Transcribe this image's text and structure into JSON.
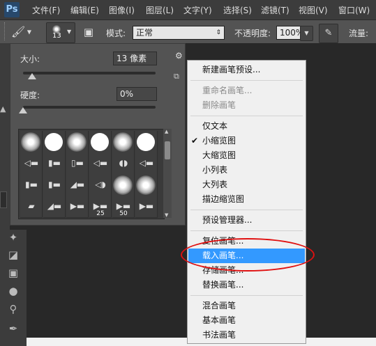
{
  "app": {
    "logo": "Ps"
  },
  "menubar": {
    "items": [
      "文件(F)",
      "编辑(E)",
      "图像(I)",
      "图层(L)",
      "文字(Y)",
      "选择(S)",
      "滤镜(T)",
      "视图(V)",
      "窗口(W)"
    ]
  },
  "options": {
    "brush_size": "13",
    "mode_label": "模式:",
    "mode_value": "正常",
    "opacity_label": "不透明度:",
    "opacity_value": "100%",
    "flow_label": "流量:"
  },
  "brush_panel": {
    "size_label": "大小:",
    "size_value": "13 像素",
    "hardness_label": "硬度:",
    "hardness_value": "0%",
    "size_slider_fraction": 0.07,
    "hardness_slider_fraction": 0.0,
    "preset_rows": [
      [
        {
          "kind": "soft"
        },
        {
          "kind": "hard"
        },
        {
          "kind": "soft"
        },
        {
          "kind": "hard"
        },
        {
          "kind": "soft"
        },
        {
          "kind": "hard"
        }
      ],
      [
        {
          "kind": "tip",
          "glyph": "◁▬"
        },
        {
          "kind": "tip",
          "glyph": "▮▬"
        },
        {
          "kind": "tip",
          "glyph": "▯▬"
        },
        {
          "kind": "tip",
          "glyph": "◁▬"
        },
        {
          "kind": "tip",
          "glyph": "◖◗"
        },
        {
          "kind": "tip",
          "glyph": "◁▬"
        }
      ],
      [
        {
          "kind": "tip",
          "glyph": "▮▬"
        },
        {
          "kind": "tip",
          "glyph": "▮▬"
        },
        {
          "kind": "tip",
          "glyph": "◢▬"
        },
        {
          "kind": "tip",
          "glyph": "◁◗"
        },
        {
          "kind": "soft"
        },
        {
          "kind": "soft"
        }
      ],
      [
        {
          "kind": "tip",
          "glyph": "▰"
        },
        {
          "kind": "tip",
          "glyph": "◢▬"
        },
        {
          "kind": "tip",
          "glyph": "▶▬"
        },
        {
          "kind": "tip",
          "glyph": "▶▬",
          "num": "25"
        },
        {
          "kind": "tip",
          "glyph": "▶▬",
          "num": "50"
        },
        {
          "kind": "tip",
          "glyph": "▶▬"
        }
      ]
    ]
  },
  "context_menu": {
    "items": [
      {
        "label": "新建画笔预设..."
      },
      {
        "sep": true
      },
      {
        "label": "重命名画笔...",
        "disabled": true
      },
      {
        "label": "删除画笔",
        "disabled": true
      },
      {
        "sep": true
      },
      {
        "label": "仅文本"
      },
      {
        "label": "小缩览图",
        "checked": true
      },
      {
        "label": "大缩览图"
      },
      {
        "label": "小列表"
      },
      {
        "label": "大列表"
      },
      {
        "label": "描边缩览图"
      },
      {
        "sep": true
      },
      {
        "label": "预设管理器..."
      },
      {
        "sep": true
      },
      {
        "label": "复位画笔..."
      },
      {
        "label": "载入画笔...",
        "selected": true
      },
      {
        "label": "存储画笔..."
      },
      {
        "label": "替换画笔..."
      },
      {
        "sep": true
      },
      {
        "label": "混合画笔"
      },
      {
        "label": "基本画笔"
      },
      {
        "label": "书法画笔"
      }
    ]
  },
  "colors": {
    "menu_highlight": "#3399ff",
    "annotation": "#e01010"
  }
}
